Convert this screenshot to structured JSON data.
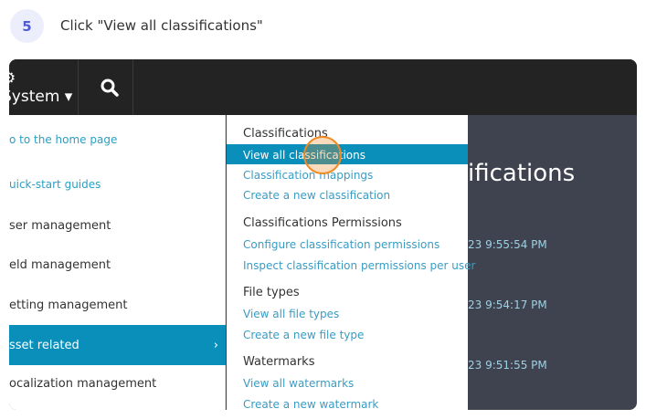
{
  "step": {
    "number": "5",
    "instruction": "Click \"View all classifications\""
  },
  "header": {
    "system_label": "⚙ System ▾",
    "search_icon": "search-icon"
  },
  "left_menu": [
    {
      "label": "o to the home page",
      "type": "link"
    },
    {
      "label": "uick-start guides",
      "type": "link"
    },
    {
      "label": "ser management",
      "type": "item"
    },
    {
      "label": "eld management",
      "type": "item"
    },
    {
      "label": "etting management",
      "type": "item"
    },
    {
      "label": "sset related",
      "type": "active",
      "chevron": "›"
    },
    {
      "label": "ocalization management",
      "type": "item"
    }
  ],
  "submenu": {
    "groups": [
      {
        "heading": "Classifications",
        "links": [
          "View all classifications",
          "Classification mappings",
          "Create a new classification"
        ]
      },
      {
        "heading": "Classifications Permissions",
        "links": [
          "Configure classification permissions",
          "Inspect classification permissions per user"
        ]
      },
      {
        "heading": "File types",
        "links": [
          "View all file types",
          "Create a new file type"
        ]
      },
      {
        "heading": "Watermarks",
        "links": [
          "View all watermarks",
          "Create a new watermark"
        ]
      }
    ]
  },
  "background": {
    "title": "ifications",
    "timestamps": [
      "23 9:55:54 PM",
      "23 9:54:17 PM",
      "23 9:51:55 PM"
    ]
  }
}
